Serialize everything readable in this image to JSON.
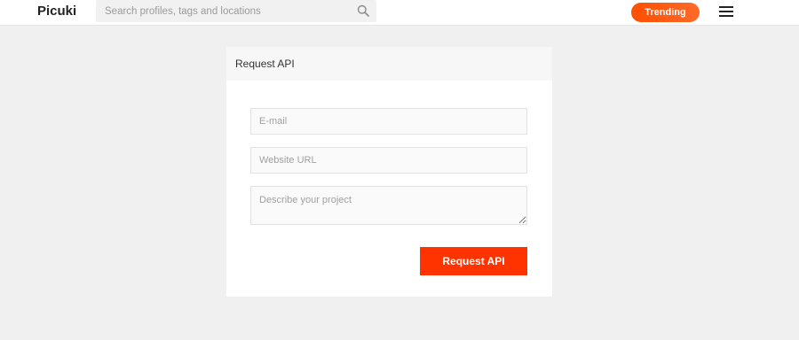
{
  "header": {
    "logo": "Picuki",
    "search": {
      "placeholder": "Search profiles, tags and locations",
      "value": ""
    },
    "trending_label": "Trending",
    "accent_color": "#ff5a1a"
  },
  "form": {
    "title": "Request API",
    "email_placeholder": "E-mail",
    "url_placeholder": "Website URL",
    "description_placeholder": "Describe your project",
    "submit_label": "Request API",
    "submit_color": "#ff3300"
  }
}
